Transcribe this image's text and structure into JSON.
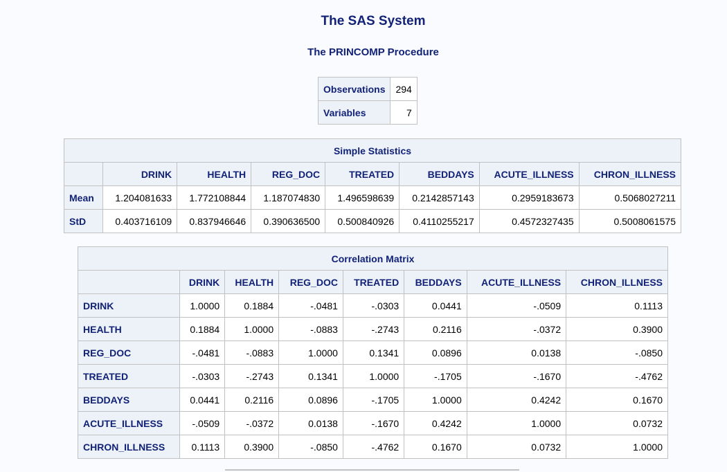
{
  "title": "The SAS System",
  "subtitle": "The PRINCOMP Procedure",
  "summary": [
    {
      "label": "Observations",
      "value": "294"
    },
    {
      "label": "Variables",
      "value": "7"
    }
  ],
  "simple_stats": {
    "caption": "Simple Statistics",
    "columns": [
      "DRINK",
      "HEALTH",
      "REG_DOC",
      "TREATED",
      "BEDDAYS",
      "ACUTE_ILLNESS",
      "CHRON_ILLNESS"
    ],
    "rows": [
      {
        "label": "Mean",
        "values": [
          "1.204081633",
          "1.772108844",
          "1.187074830",
          "1.496598639",
          "0.2142857143",
          "0.2959183673",
          "0.5068027211"
        ]
      },
      {
        "label": "StD",
        "values": [
          "0.403716109",
          "0.837946646",
          "0.390636500",
          "0.500840926",
          "0.4110255217",
          "0.4572327435",
          "0.5008061575"
        ]
      }
    ]
  },
  "correlation": {
    "caption": "Correlation Matrix",
    "columns": [
      "DRINK",
      "HEALTH",
      "REG_DOC",
      "TREATED",
      "BEDDAYS",
      "ACUTE_ILLNESS",
      "CHRON_ILLNESS"
    ],
    "rows": [
      {
        "label": "DRINK",
        "values": [
          "1.0000",
          "0.1884",
          "-.0481",
          "-.0303",
          "0.0441",
          "-.0509",
          "0.1113"
        ]
      },
      {
        "label": "HEALTH",
        "values": [
          "0.1884",
          "1.0000",
          "-.0883",
          "-.2743",
          "0.2116",
          "-.0372",
          "0.3900"
        ]
      },
      {
        "label": "REG_DOC",
        "values": [
          "-.0481",
          "-.0883",
          "1.0000",
          "0.1341",
          "0.0896",
          "0.0138",
          "-.0850"
        ]
      },
      {
        "label": "TREATED",
        "values": [
          "-.0303",
          "-.2743",
          "0.1341",
          "1.0000",
          "-.1705",
          "-.1670",
          "-.4762"
        ]
      },
      {
        "label": "BEDDAYS",
        "values": [
          "0.0441",
          "0.2116",
          "0.0896",
          "-.1705",
          "1.0000",
          "0.4242",
          "0.1670"
        ]
      },
      {
        "label": "ACUTE_ILLNESS",
        "values": [
          "-.0509",
          "-.0372",
          "0.0138",
          "-.1670",
          "0.4242",
          "1.0000",
          "0.0732"
        ]
      },
      {
        "label": "CHRON_ILLNESS",
        "values": [
          "0.1113",
          "0.3900",
          "-.0850",
          "-.4762",
          "0.1670",
          "0.0732",
          "1.0000"
        ]
      }
    ]
  }
}
